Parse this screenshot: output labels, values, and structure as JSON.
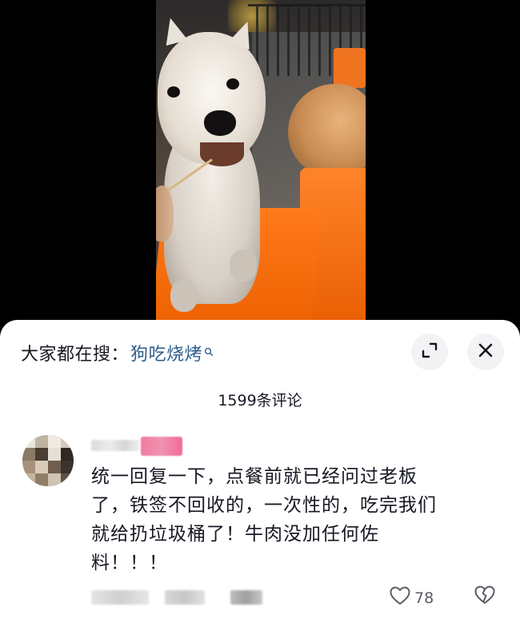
{
  "topic_bar": {
    "label": "大家都在搜：",
    "keyword": "狗吃烧烤"
  },
  "comments_header": {
    "count_text": "1599条评论"
  },
  "comment": {
    "text": "统一回复一下，点餐前就已经问过老板\n了，铁签不回收的，一次性的，吃完我们\n就给扔垃圾桶了！牛肉没加任何佐\n料！！！",
    "like_count": "78"
  },
  "icons": {
    "expand": "expand-icon",
    "close": "close-icon",
    "search": "search-icon",
    "like": "heart-outline-icon",
    "dislike": "broken-heart-icon"
  },
  "colors": {
    "link": "#2f5e8c",
    "text": "#161823",
    "secondary": "#5b5b66"
  }
}
